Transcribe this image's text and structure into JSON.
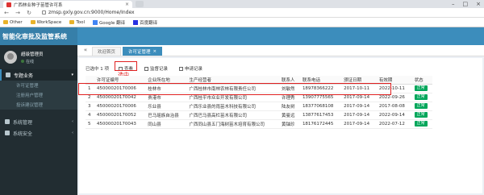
{
  "browser": {
    "tab_title": "广西林业种子苗管许可系",
    "url": "zmsp.gxly.gov.cn:9000/Home/Index",
    "bookmarks": [
      "Other",
      "WorkSpace",
      "Tool",
      "Google 翻译",
      "百度翻译"
    ]
  },
  "app": {
    "title": "智能化审批及监管系统",
    "user": {
      "name": "超级管理员",
      "status": "在线"
    },
    "menu": {
      "active_group": "专题业务",
      "items": [
        "许可证管理",
        "注册用户管理",
        "投诉建议管理"
      ],
      "groups": [
        "系统管理",
        "系统安全"
      ]
    },
    "tabs": [
      "欢迎首页",
      "许可证管理"
    ],
    "toolbar": {
      "selected": "已选中 1 项",
      "view": "查看",
      "supervise": "监督记录",
      "apply": "申请记录"
    },
    "annotation": "选中",
    "table": {
      "headers": [
        "",
        "许可证编号",
        "企业所在地",
        "生产经营者",
        "联系人",
        "联系电话",
        "颁证日期",
        "有效期",
        "状态"
      ],
      "rows": [
        [
          "1",
          "45000020170006",
          "桂林市",
          "广西桂林市南林农林有限责任公司",
          "刘敏然",
          "18978366222",
          "2017-10-11",
          "2022-10-11",
          "正常"
        ],
        [
          "2",
          "45000020170042",
          "贵港市",
          "广西桂平市众业开发有限公司",
          "许理秀",
          "13907775565",
          "2017-09-14",
          "2022-09-26",
          "正常"
        ],
        [
          "3",
          "45000020170006",
          "乐业县",
          "广西乐业县的雨苗木科技有限公司",
          "陆友树",
          "18377068108",
          "2017-09-14",
          "2017-08-08",
          "正常"
        ],
        [
          "4",
          "45000020170052",
          "巴马瑶族自治县",
          "广西巴马县高栏苗木有限公司",
          "黄曼远",
          "13877617453",
          "2017-09-14",
          "2022-09-14",
          "正常"
        ],
        [
          "5",
          "45000020170043",
          "同山县",
          "广西同山县五门海树苗木培育有限公司",
          "黄铀珍",
          "18176172445",
          "2017-09-14",
          "2022-07-12",
          "正常"
        ]
      ]
    }
  },
  "colors": {
    "header": "#3c8dbc",
    "sidebar": "#222d32",
    "highlight": "#e02020",
    "badge": "#00a65a"
  }
}
